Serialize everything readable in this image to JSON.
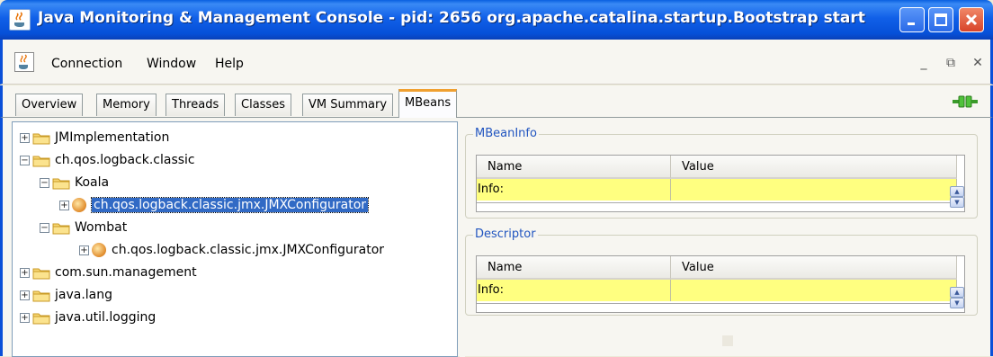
{
  "window": {
    "title": "Java Monitoring & Management Console - pid: 2656 org.apache.catalina.startup.Bootstrap start",
    "minimize_icon": "minimize-icon",
    "maximize_icon": "maximize-icon",
    "close_icon": "close-icon"
  },
  "menubar": {
    "items": [
      "Connection",
      "Window",
      "Help"
    ],
    "mdi_buttons": [
      "_",
      "⧉",
      "✕"
    ]
  },
  "tabs": [
    {
      "label": "Overview",
      "active": false
    },
    {
      "label": "Memory",
      "active": false
    },
    {
      "label": "Threads",
      "active": false
    },
    {
      "label": "Classes",
      "active": false
    },
    {
      "label": "VM Summary",
      "active": false
    },
    {
      "label": "MBeans",
      "active": true
    }
  ],
  "tree": {
    "nodes": [
      {
        "label": "JMImplementation",
        "level": 0,
        "type": "folder",
        "expanded": false
      },
      {
        "label": "ch.qos.logback.classic",
        "level": 0,
        "type": "folder",
        "expanded": true
      },
      {
        "label": "Koala",
        "level": 1,
        "type": "folder",
        "expanded": true
      },
      {
        "label": "ch.qos.logback.classic.jmx.JMXConfigurator",
        "level": 2,
        "type": "bean",
        "expanded": false,
        "selected": true
      },
      {
        "label": "Wombat",
        "level": 1,
        "type": "folder",
        "expanded": true
      },
      {
        "label": "ch.qos.logback.classic.jmx.JMXConfigurator",
        "level": 2,
        "type": "bean",
        "expanded": false,
        "selected": false
      },
      {
        "label": "com.sun.management",
        "level": 0,
        "type": "folder",
        "expanded": false
      },
      {
        "label": "java.lang",
        "level": 0,
        "type": "folder",
        "expanded": false
      },
      {
        "label": "java.util.logging",
        "level": 0,
        "type": "folder",
        "expanded": false
      }
    ]
  },
  "mbeaninfo": {
    "title": "MBeanInfo",
    "columns": [
      "Name",
      "Value"
    ],
    "rows": [
      {
        "name": "Info:",
        "value": ""
      }
    ]
  },
  "descriptor": {
    "title": "Descriptor",
    "columns": [
      "Name",
      "Value"
    ],
    "rows": [
      {
        "name": "Info:",
        "value": ""
      }
    ]
  },
  "colors": {
    "titlebar": "#0a5fe0",
    "selection": "#316ac5",
    "highlight_row": "#ffff80",
    "group_title": "#2155c0"
  }
}
